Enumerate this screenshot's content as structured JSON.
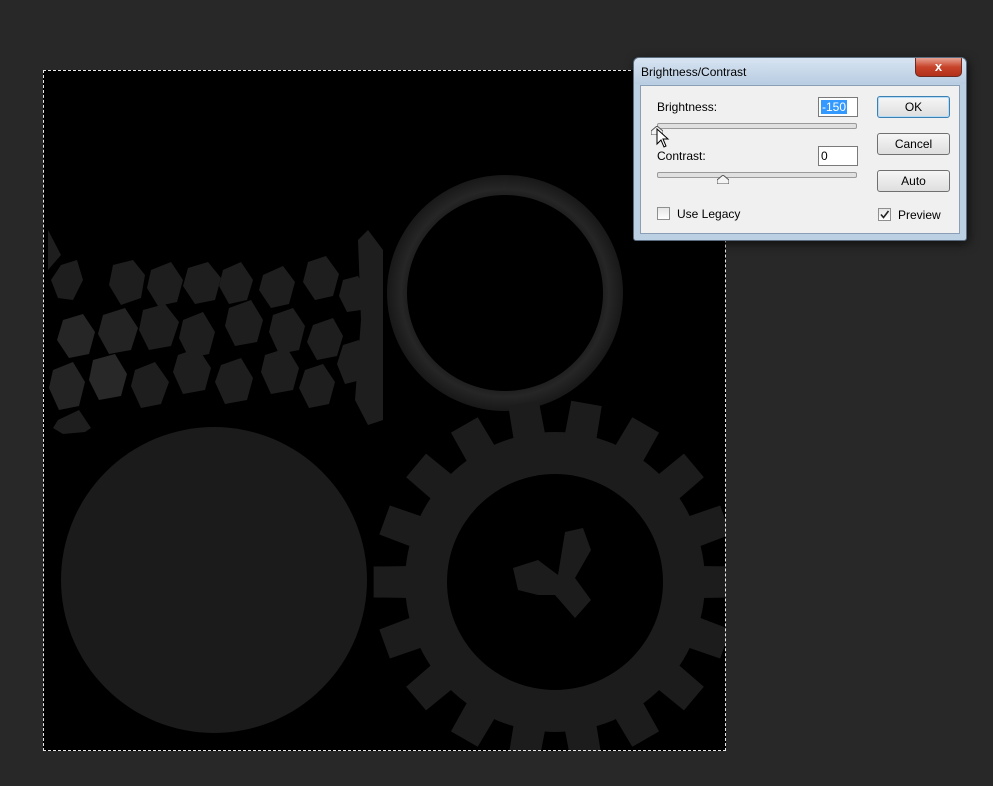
{
  "dialog": {
    "title": "Brightness/Contrast",
    "close_glyph": "x",
    "brightness": {
      "label": "Brightness:",
      "value": "-150",
      "range": [
        -150,
        150
      ]
    },
    "contrast": {
      "label": "Contrast:",
      "value": "0",
      "range": [
        -50,
        100
      ]
    },
    "buttons": {
      "ok": "OK",
      "cancel": "Cancel",
      "auto": "Auto"
    },
    "use_legacy": {
      "label": "Use Legacy",
      "checked": false
    },
    "preview": {
      "label": "Preview",
      "checked": true
    }
  },
  "colors": {
    "workspace_bg": "#282828",
    "canvas_bg": "#000000",
    "shape_fill": "#1c1c1c",
    "selection_highlight": "#3399ff",
    "close_button": "#c7442a"
  },
  "icons": {
    "cursor": "arrow-pointer-icon",
    "check": "checkmark-icon",
    "slider_thumb": "triangle-up-icon"
  }
}
